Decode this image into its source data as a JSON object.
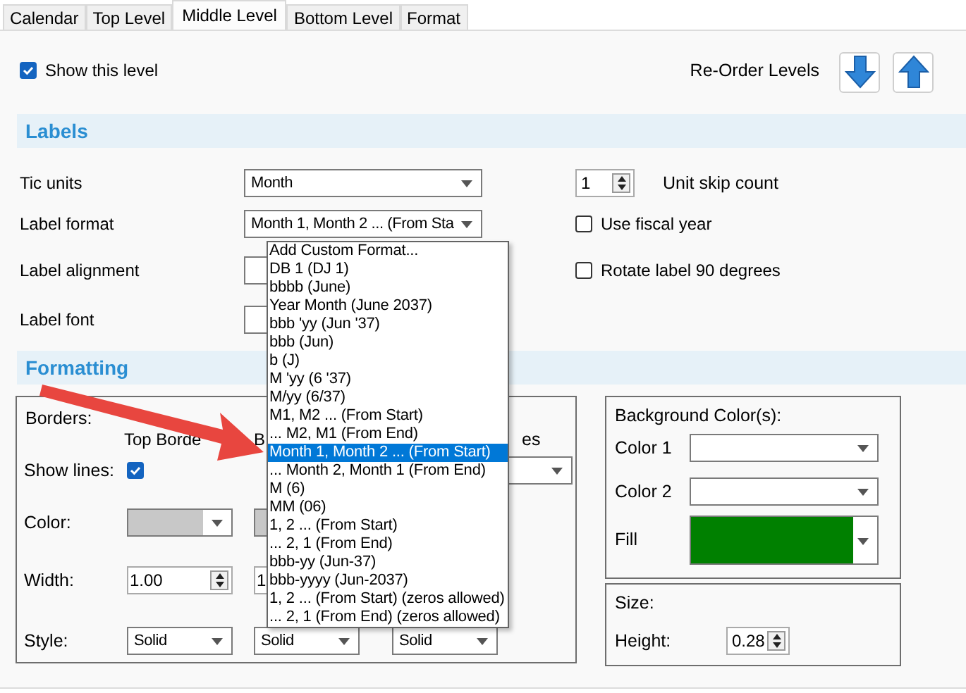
{
  "tabs": [
    {
      "label": "Calendar",
      "selected": false
    },
    {
      "label": "Top Level",
      "selected": false
    },
    {
      "label": "Middle Level",
      "selected": true
    },
    {
      "label": "Bottom Level",
      "selected": false
    },
    {
      "label": "Format",
      "selected": false
    }
  ],
  "show_level": {
    "label": "Show this level",
    "checked": true
  },
  "reorder": {
    "label": "Re-Order Levels"
  },
  "labels_section": {
    "title": "Labels",
    "rows": [
      {
        "label": "Tic units",
        "combo": "Month"
      },
      {
        "label": "Label format",
        "combo": "Month 1, Month 2 ... (From Sta"
      },
      {
        "label": "Label alignment"
      },
      {
        "label": "Label font"
      }
    ],
    "unit_skip": {
      "value": "1",
      "label": "Unit skip count"
    },
    "options": [
      {
        "label": "Use fiscal year",
        "checked": false
      },
      {
        "label": "Rotate label 90 degrees",
        "checked": false
      }
    ]
  },
  "format_list": [
    {
      "text": "Add Custom Format...",
      "selected": false
    },
    {
      "text": "DB 1 (DJ 1)",
      "selected": false
    },
    {
      "text": "bbbb (June)",
      "selected": false
    },
    {
      "text": "Year Month (June 2037)",
      "selected": false
    },
    {
      "text": "bbb 'yy (Jun '37)",
      "selected": false
    },
    {
      "text": "bbb (Jun)",
      "selected": false
    },
    {
      "text": "b (J)",
      "selected": false
    },
    {
      "text": "M 'yy (6 '37)",
      "selected": false
    },
    {
      "text": "M/yy (6/37)",
      "selected": false
    },
    {
      "text": "M1, M2 ... (From Start)",
      "selected": false
    },
    {
      "text": "... M2, M1 (From End)",
      "selected": false
    },
    {
      "text": "Month 1, Month 2 ... (From Start)",
      "selected": true
    },
    {
      "text": "... Month 2, Month 1 (From End)",
      "selected": false
    },
    {
      "text": "M (6)",
      "selected": false
    },
    {
      "text": "MM (06)",
      "selected": false
    },
    {
      "text": "1, 2 ... (From Start)",
      "selected": false
    },
    {
      "text": "... 2, 1 (From End)",
      "selected": false
    },
    {
      "text": "bbb-yy (Jun-37)",
      "selected": false
    },
    {
      "text": "bbb-yyyy (Jun-2037)",
      "selected": false
    },
    {
      "text": "1, 2 ... (From Start) (zeros allowed)",
      "selected": false
    },
    {
      "text": "... 2, 1 (From End) (zeros allowed)",
      "selected": false
    }
  ],
  "formatting_section": {
    "title": "Formatting",
    "borders": {
      "title": "Borders:",
      "headers": [
        "Top Borde",
        "B",
        "es"
      ],
      "show_lines": {
        "label": "Show lines:",
        "checked": true
      },
      "color": {
        "label": "Color:",
        "swatches": [
          {
            "color": "#c8c8c8"
          },
          {
            "color": "#c8c8c8"
          }
        ]
      },
      "width": {
        "label": "Width:",
        "values": [
          "1.00",
          "1"
        ]
      },
      "style": {
        "label": "Style:",
        "values": [
          "Solid",
          "Solid",
          "Solid"
        ]
      }
    },
    "background": {
      "title": "Background Color(s):",
      "rows": [
        {
          "label": "Color 1",
          "color": "#ffffff"
        },
        {
          "label": "Color 2",
          "color": "#ffffff"
        },
        {
          "label": "Fill",
          "color": "#008000"
        }
      ]
    },
    "size": {
      "title": "Size:",
      "label": "Height:",
      "value": "0.28"
    }
  }
}
